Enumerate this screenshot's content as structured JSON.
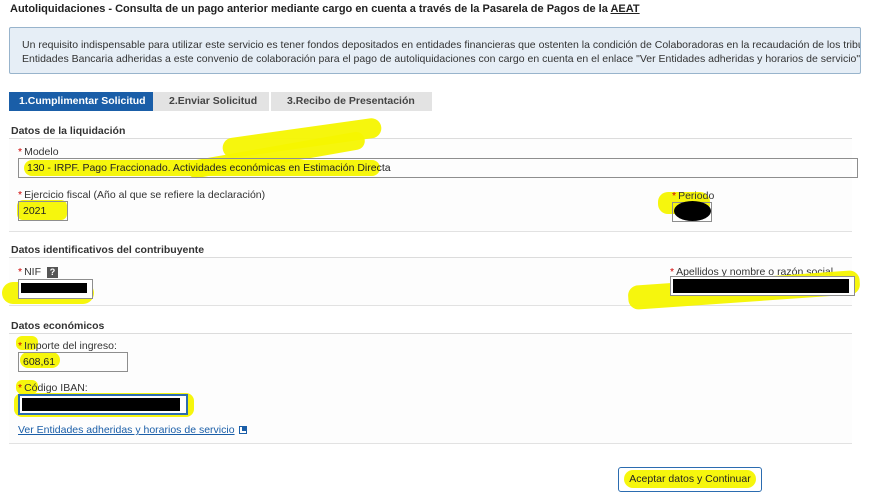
{
  "title": {
    "prefix": "Autoliquidaciones - Consulta de un pago anterior mediante cargo en cuenta a través de la Pasarela de Pagos de la ",
    "suffix": "AEAT"
  },
  "info": {
    "line1": "Un requisito indispensable para utilizar este servicio es tener fondos depositados en entidades financieras que ostenten la condición de Colaboradoras en la recaudación de los tribut",
    "line2": "Entidades Bancaria adheridas a este convenio de colaboración para el pago de autoliquidaciones con cargo en cuenta en el enlace \"Ver Entidades adheridas y horarios de servicio\"._"
  },
  "steps": [
    {
      "label": "1.Cumplimentar Solicitud",
      "state": "active"
    },
    {
      "label": "2.Enviar Solicitud",
      "state": "inactive"
    },
    {
      "label": "3.Recibo de Presentación",
      "state": "inactive"
    }
  ],
  "liquidacion": {
    "section_title": "Datos de la liquidación",
    "modelo_label": "Modelo",
    "modelo_value": "130 - IRPF. Pago Fraccionado. Actividades económicas en Estimación Directa",
    "ejercicio_label": "Ejercicio fiscal (Año al que se refiere la declaración)",
    "ejercicio_value": "2021",
    "periodo_label": "Periodo"
  },
  "contribuyente": {
    "section_title": "Datos identificativos del contribuyente",
    "nif_label": "NIF",
    "help": "?",
    "nombre_label": "Apellidos y nombre o razón social"
  },
  "economicos": {
    "section_title": "Datos económicos",
    "importe_label": "Importe del ingreso:",
    "importe_value": "608,61",
    "iban_label": "Código IBAN:",
    "link_label": "Ver Entidades adheridas y horarios de servicio"
  },
  "actions": {
    "submit_label": "Aceptar datos y Continuar"
  },
  "required_mark": "*",
  "colors": {
    "accent": "#1a5ea8",
    "highlight": "#f5f500",
    "info_bg": "#e6eef6",
    "required": "#cc0000"
  }
}
